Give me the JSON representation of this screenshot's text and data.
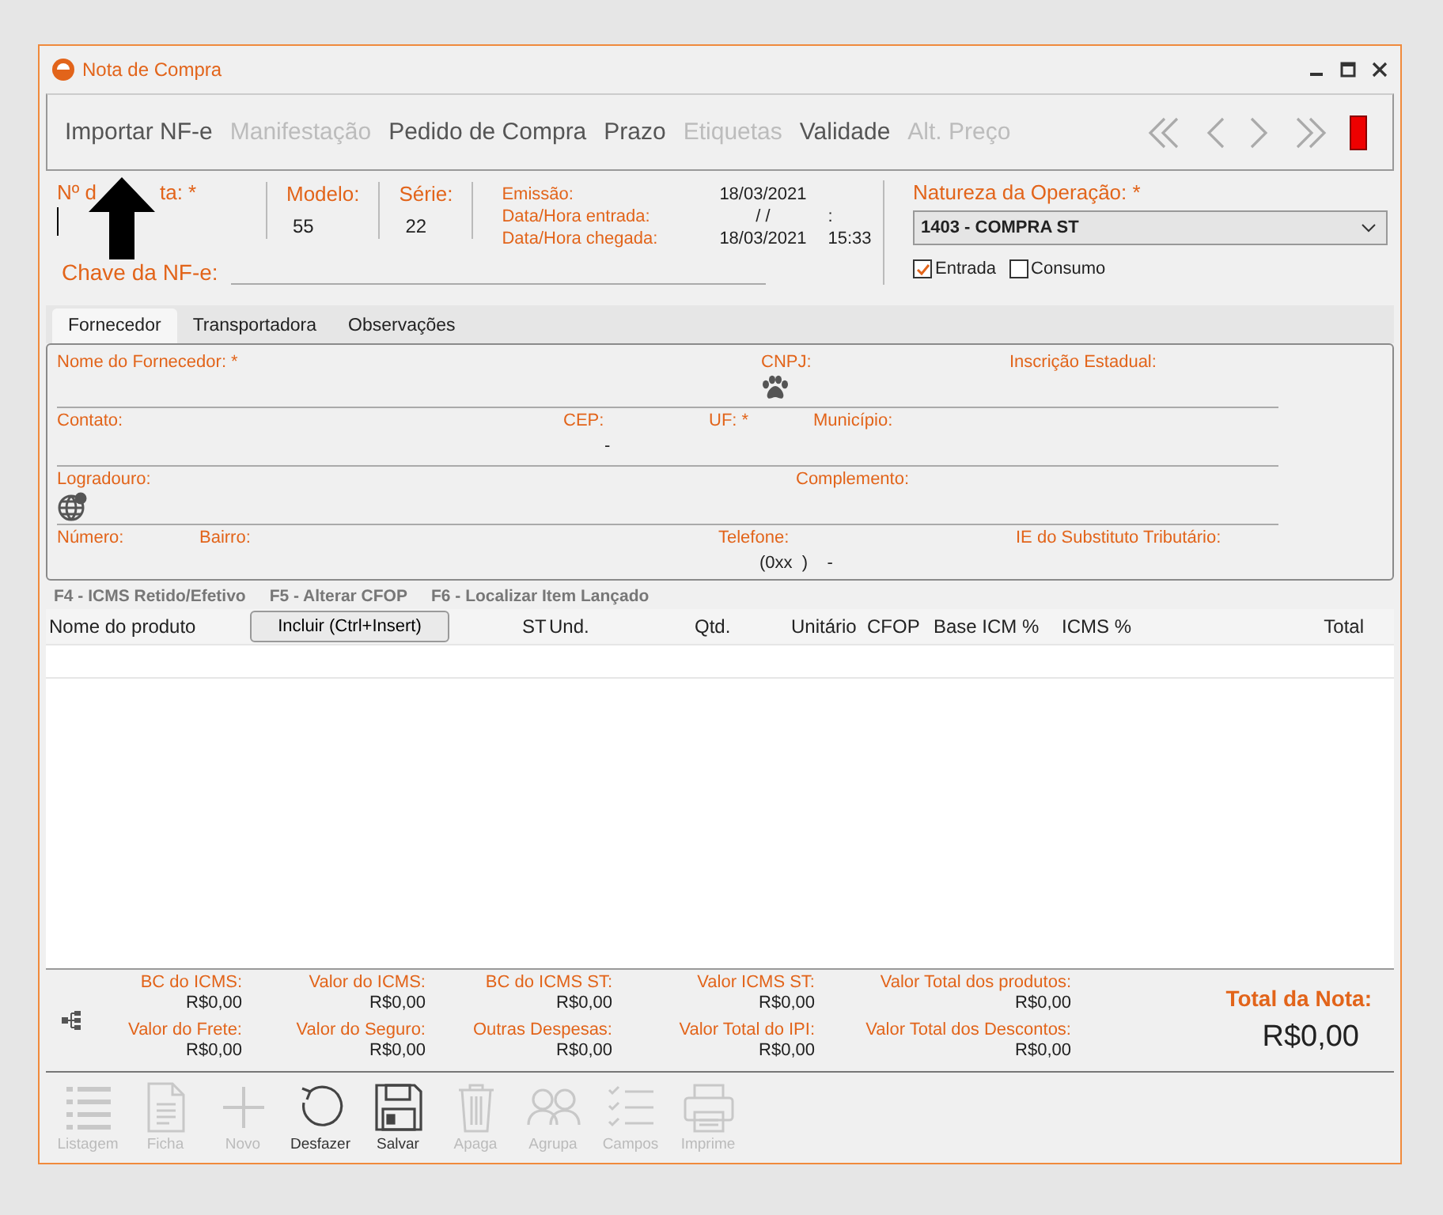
{
  "window": {
    "title": "Nota de Compra"
  },
  "menu": [
    {
      "label": "Importar NF-e",
      "disabled": false
    },
    {
      "label": "Manifestação",
      "disabled": true
    },
    {
      "label": "Pedido de Compra",
      "disabled": false
    },
    {
      "label": "Prazo",
      "disabled": false
    },
    {
      "label": "Etiquetas",
      "disabled": true
    },
    {
      "label": "Validade",
      "disabled": false
    },
    {
      "label": "Alt. Preço",
      "disabled": true
    }
  ],
  "header": {
    "numero_label_parts": [
      "Nº d",
      "ta: *"
    ],
    "modelo": {
      "label": "Modelo:",
      "value": "55"
    },
    "serie": {
      "label": "Série:",
      "value": "22"
    },
    "dates": [
      {
        "label": "Emissão:",
        "date": "18/03/2021"
      },
      {
        "label": "Data/Hora entrada:",
        "date": "/  /",
        "time": ":"
      },
      {
        "label": "Data/Hora chegada:",
        "date": "18/03/2021",
        "time": "15:33"
      }
    ],
    "chave_label": "Chave da NF-e:",
    "natureza": {
      "label": "Natureza da Operação: *",
      "value": "1403 - COMPRA ST"
    },
    "checks": [
      {
        "label": "Entrada",
        "checked": true
      },
      {
        "label": "Consumo",
        "checked": false
      }
    ]
  },
  "tabs": [
    {
      "label": "Fornecedor",
      "selected": true
    },
    {
      "label": "Transportadora",
      "selected": false
    },
    {
      "label": "Observações",
      "selected": false
    }
  ],
  "supplier_rows": [
    [
      {
        "label": "Nome do Fornecedor: *"
      },
      {
        "label": "CNPJ:"
      },
      {
        "label": "Inscrição Estadual:"
      }
    ],
    [
      {
        "label": "Contato:"
      },
      {
        "label": "CEP:",
        "value": "-"
      },
      {
        "label": "UF: *"
      },
      {
        "label": "Município:"
      }
    ],
    [
      {
        "label": "Logradouro:"
      },
      {
        "label": "Complemento:"
      }
    ],
    [
      {
        "label": "Número:"
      },
      {
        "label": "Bairro:"
      },
      {
        "label": "Telefone:",
        "value": "(0xx  )    -"
      },
      {
        "label": "IE do Substituto Tributário:"
      }
    ]
  ],
  "shortcuts": [
    "F4 - ICMS Retido/Efetivo",
    "F5 - Alterar CFOP",
    "F6 - Localizar Item Lançado"
  ],
  "grid": {
    "first_column": "Nome do produto",
    "include_button": "Incluir (Ctrl+Insert)",
    "columns": [
      "ST",
      "Und.",
      "Qtd.",
      "Unitário",
      "CFOP",
      "Base ICM %",
      "ICMS %",
      "Total"
    ]
  },
  "totals": [
    {
      "label": "BC do ICMS:",
      "value": "R$0,00"
    },
    {
      "label": "Valor do ICMS:",
      "value": "R$0,00"
    },
    {
      "label": "BC do ICMS ST:",
      "value": "R$0,00"
    },
    {
      "label": "Valor ICMS ST:",
      "value": "R$0,00"
    },
    {
      "label": "Valor Total dos produtos:",
      "value": "R$0,00"
    },
    {
      "label": "Valor do Frete:",
      "value": "R$0,00"
    },
    {
      "label": "Valor do Seguro:",
      "value": "R$0,00"
    },
    {
      "label": "Outras Despesas:",
      "value": "R$0,00"
    },
    {
      "label": "Valor Total do IPI:",
      "value": "R$0,00"
    },
    {
      "label": "Valor Total dos Descontos:",
      "value": "R$0,00"
    }
  ],
  "total_nota": {
    "label": "Total da Nota:",
    "value": "R$0,00"
  },
  "actions": [
    {
      "label": "Listagem",
      "disabled": true
    },
    {
      "label": "Ficha",
      "disabled": true
    },
    {
      "label": "Novo",
      "disabled": true
    },
    {
      "label": "Desfazer",
      "disabled": false
    },
    {
      "label": "Salvar",
      "disabled": false
    },
    {
      "label": "Apaga",
      "disabled": true
    },
    {
      "label": "Agrupa",
      "disabled": true
    },
    {
      "label": "Campos",
      "disabled": true
    },
    {
      "label": "Imprime",
      "disabled": true
    }
  ]
}
